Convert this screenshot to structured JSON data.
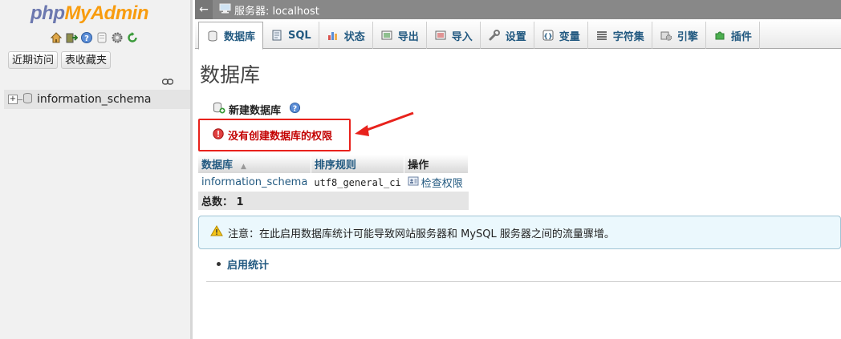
{
  "app": {
    "logo_php": "php",
    "logo_my": "MyAdmin"
  },
  "nav": {
    "icons": [
      "home-icon",
      "exit-icon",
      "help-icon",
      "docs-icon",
      "settings-icon",
      "reload-icon"
    ],
    "recent_label": "近期访问",
    "favorites_label": "表收藏夹",
    "tree": [
      {
        "label": "information_schema",
        "expand": "+"
      }
    ]
  },
  "topbar": {
    "back": "←",
    "server_label": "服务器: localhost"
  },
  "tabs": [
    {
      "label": "数据库",
      "icon": "database-icon",
      "active": true
    },
    {
      "label": "SQL",
      "icon": "sql-icon"
    },
    {
      "label": "状态",
      "icon": "status-icon"
    },
    {
      "label": "导出",
      "icon": "export-icon"
    },
    {
      "label": "导入",
      "icon": "import-icon"
    },
    {
      "label": "设置",
      "icon": "wrench-icon"
    },
    {
      "label": "变量",
      "icon": "variables-icon"
    },
    {
      "label": "字符集",
      "icon": "charset-icon"
    },
    {
      "label": "引擎",
      "icon": "engine-icon"
    },
    {
      "label": "插件",
      "icon": "plugin-icon"
    }
  ],
  "main": {
    "title": "数据库",
    "create_db_label": "新建数据库",
    "error_text": "没有创建数据库的权限",
    "annotation_color": "#e8221c",
    "table": {
      "headers": {
        "database": "数据库",
        "collation": "排序规则",
        "action": "操作"
      },
      "sort_indicator": "▲",
      "rows": [
        {
          "database": "information_schema",
          "collation": "utf8_general_ci",
          "action": "检查权限"
        }
      ],
      "total_label": "总数：",
      "total_value": "1"
    },
    "notice_text": "注意：在此启用数据库统计可能导致网站服务器和 MySQL 服务器之间的流量骤增。",
    "enable_stats_label": "启用统计"
  },
  "colors": {
    "link": "#235a81",
    "error": "#c30000",
    "logo_php": "#6c78af",
    "logo_myadmin": "#f89c0e"
  }
}
